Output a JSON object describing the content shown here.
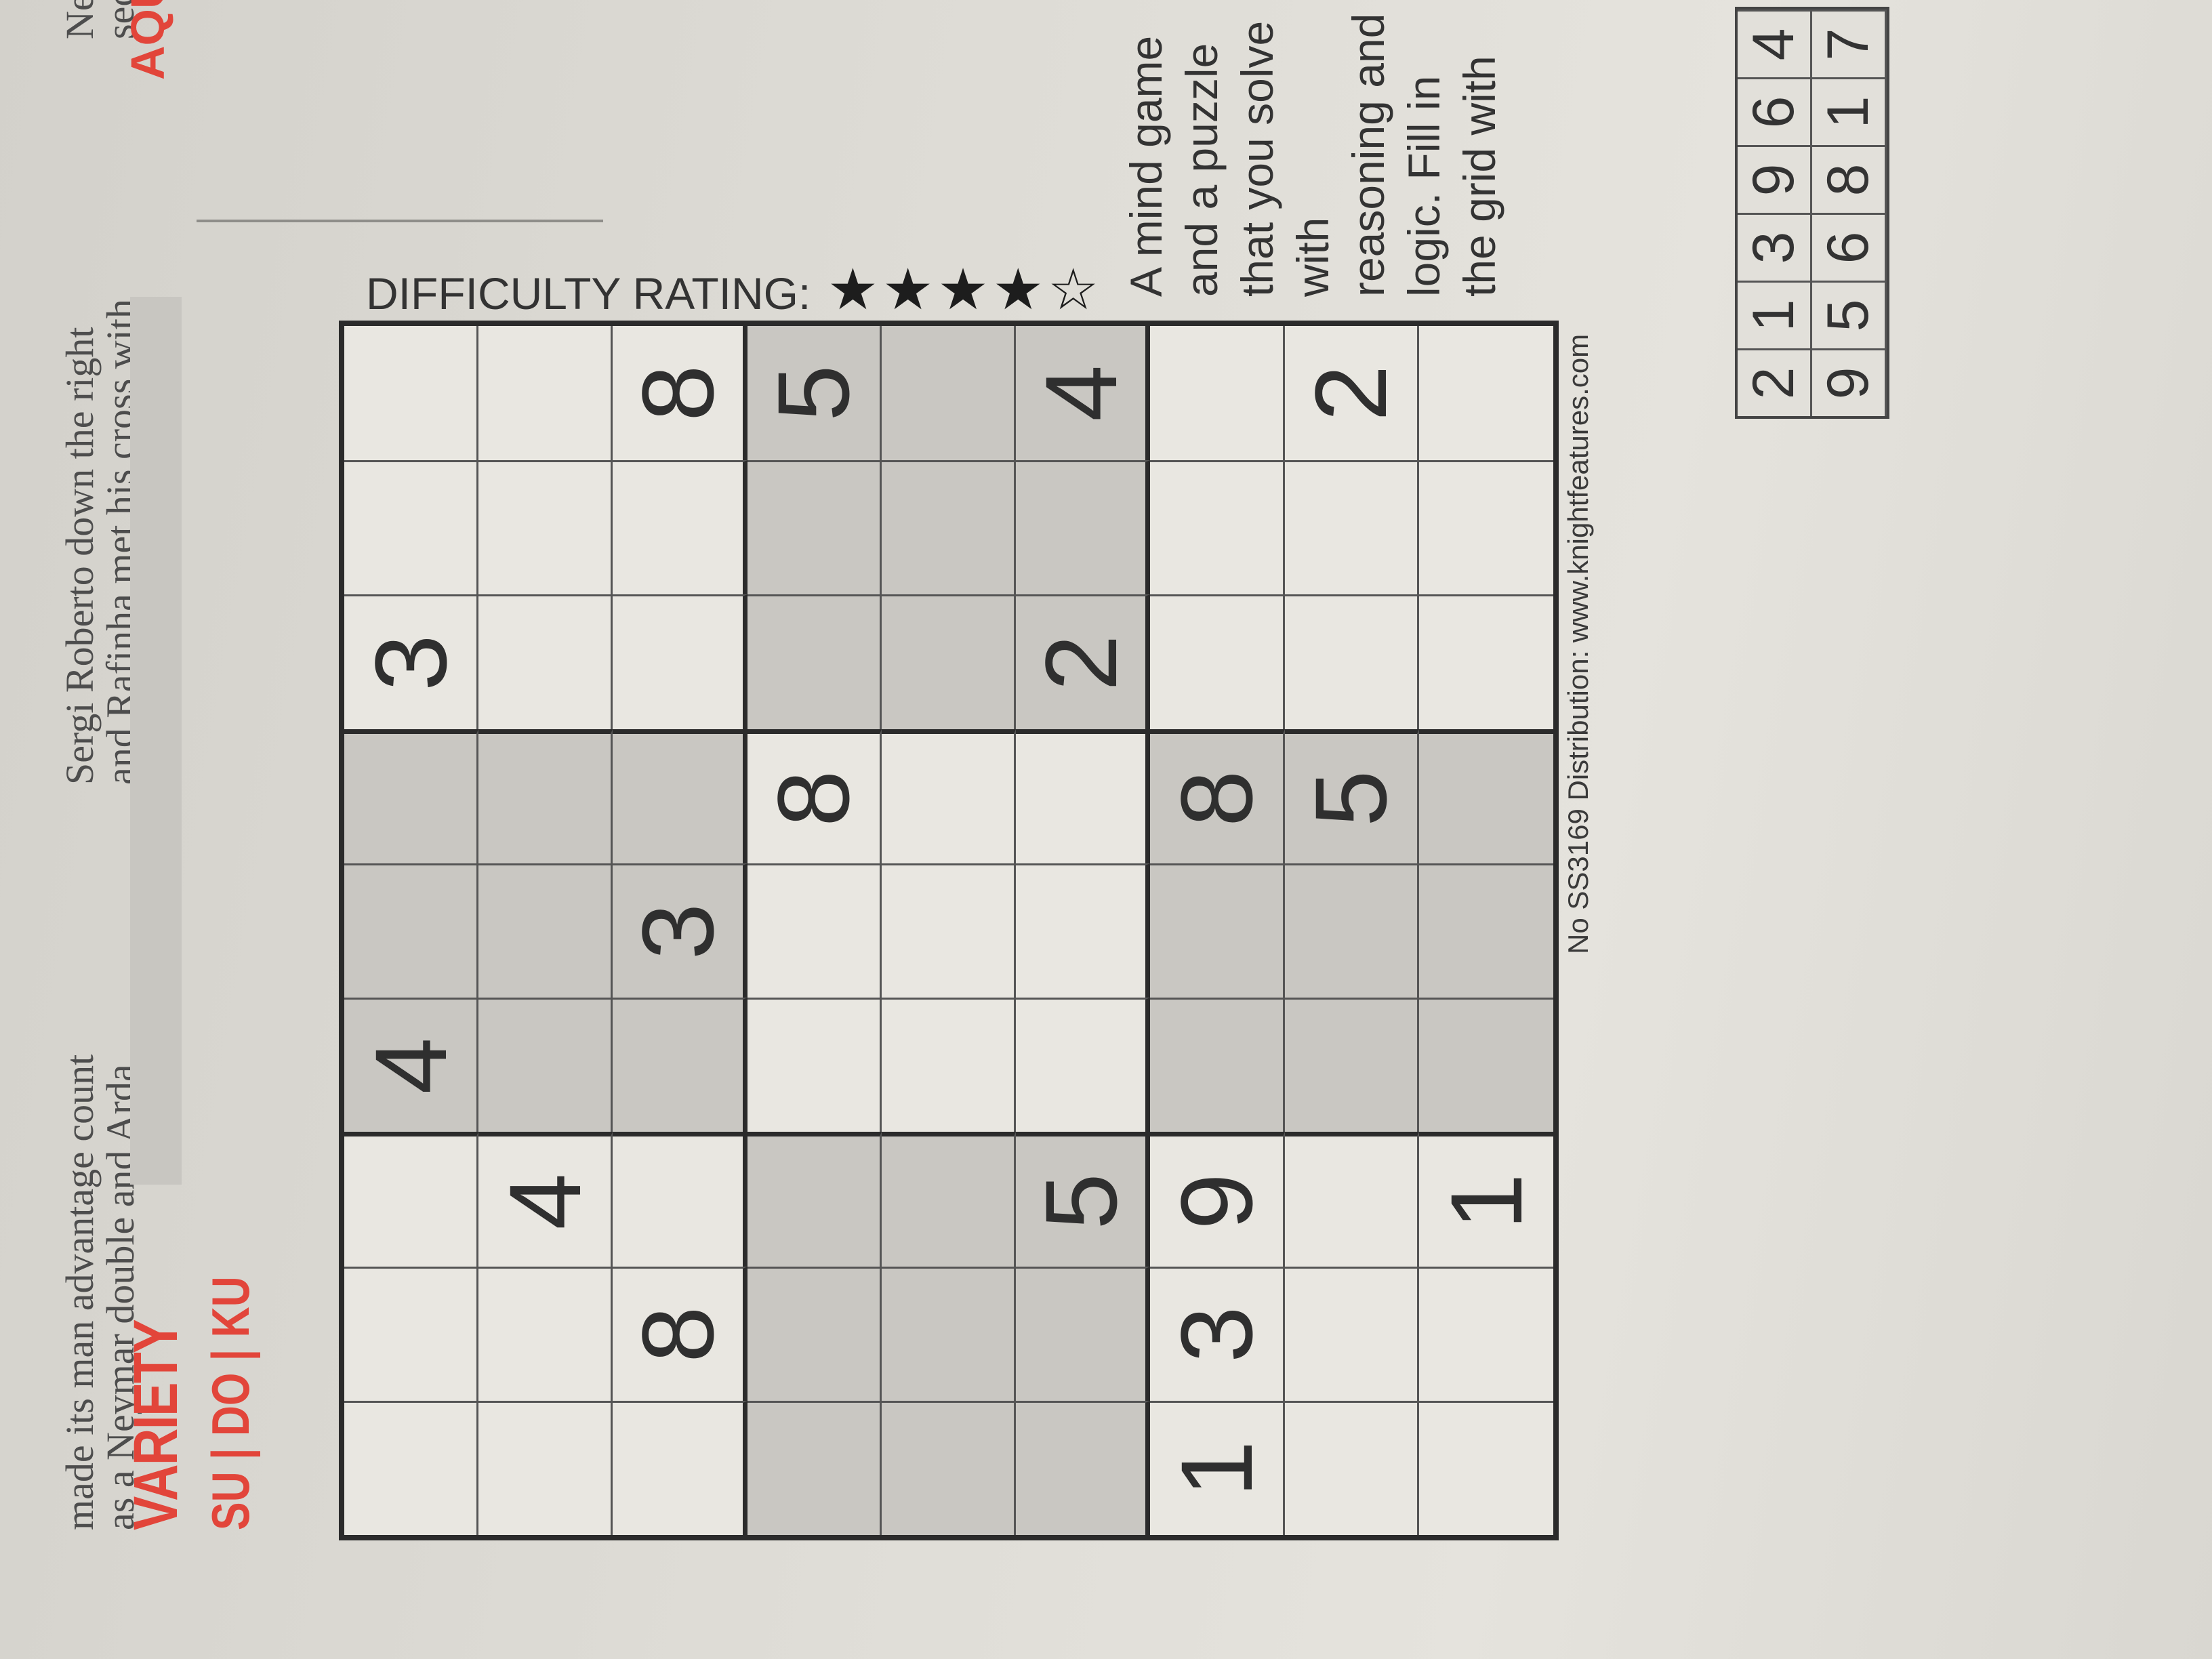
{
  "news": {
    "left_lines": [
      "made its man advantage count",
      "as a Neymar double and Arda"
    ],
    "right_lines": [
      "Sergi Roberto down the right",
      "and Rafinha met his cross with"
    ],
    "right2_lines": [
      "Neym",
      "secon"
    ]
  },
  "section": {
    "variety": "VARIETY",
    "aquarius": "AQU",
    "title": "SU | DO | KU"
  },
  "sudoku": {
    "grid": [
      [
        "",
        "",
        "",
        "4",
        "",
        "",
        "3",
        "",
        ""
      ],
      [
        "",
        "",
        "4",
        "",
        "",
        "",
        "",
        "",
        ""
      ],
      [
        "",
        "8",
        "",
        "",
        "3",
        "",
        "",
        "",
        "8"
      ],
      [
        "",
        "",
        "",
        "",
        "",
        "8",
        "",
        "",
        "5"
      ],
      [
        "",
        "",
        "",
        "",
        "",
        "",
        "",
        "",
        ""
      ],
      [
        "",
        "",
        "5",
        "",
        "",
        "",
        "2",
        "",
        "4"
      ],
      [
        "1",
        "3",
        "9",
        "",
        "",
        "8",
        "",
        "",
        ""
      ],
      [
        "",
        "",
        "",
        "",
        "",
        "5",
        "",
        "",
        "2"
      ],
      [
        "",
        "",
        "1",
        "",
        "",
        "",
        "",
        "",
        ""
      ]
    ],
    "footer": "No SS3169 Distribution: www.knightfeatures.com"
  },
  "difficulty": {
    "label": "DIFFICULTY RATING:",
    "filled_stars": 4,
    "total_stars": 5
  },
  "description": "A mind game and a puzzle that you solve with reasoning and logic. Fill in the grid with",
  "previous_solution": {
    "rows": [
      [
        "2",
        "1",
        "3",
        "9",
        "6",
        "4"
      ],
      [
        "9",
        "5",
        "6",
        "8",
        "1",
        "7"
      ]
    ]
  }
}
